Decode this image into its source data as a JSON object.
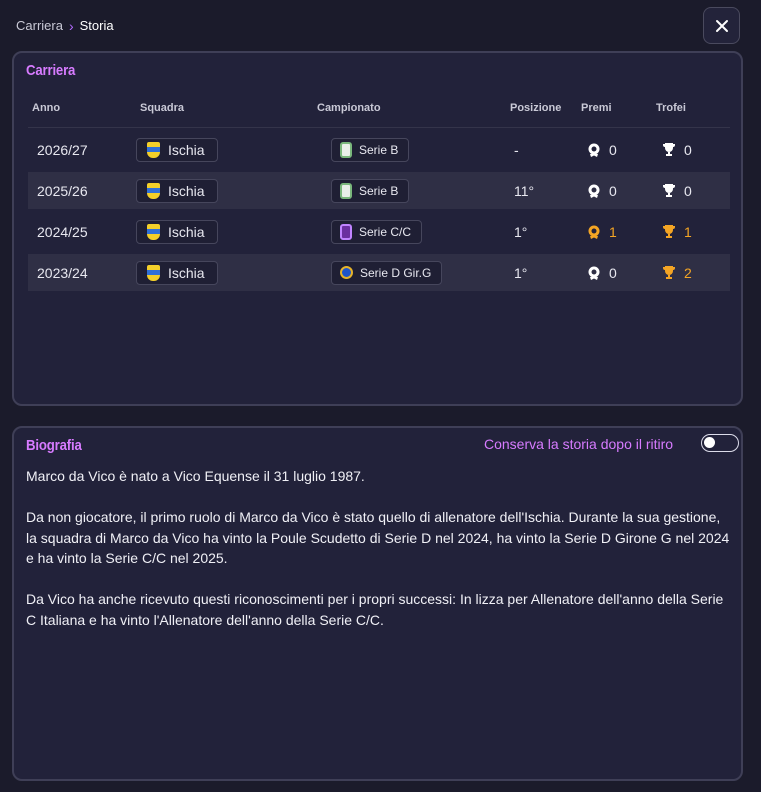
{
  "breadcrumb": {
    "parent": "Carriera",
    "current": "Storia"
  },
  "career": {
    "title": "Carriera",
    "columns": [
      "Anno",
      "Squadra",
      "Campionato",
      "Posizione",
      "Premi",
      "Trofei"
    ],
    "rows": [
      {
        "year": "2026/27",
        "team": "Ischia",
        "league": "Serie B",
        "league_icon": "serie-b-badge",
        "position": "-",
        "awards": "0",
        "trophies": "0",
        "awards_highlight": false,
        "trophies_highlight": false
      },
      {
        "year": "2025/26",
        "team": "Ischia",
        "league": "Serie B",
        "league_icon": "serie-b-badge",
        "position": "11°",
        "awards": "0",
        "trophies": "0",
        "awards_highlight": false,
        "trophies_highlight": false
      },
      {
        "year": "2024/25",
        "team": "Ischia",
        "league": "Serie C/C",
        "league_icon": "serie-c-badge",
        "position": "1°",
        "awards": "1",
        "trophies": "1",
        "awards_highlight": true,
        "trophies_highlight": true
      },
      {
        "year": "2023/24",
        "team": "Ischia",
        "league": "Serie D Gir.G",
        "league_icon": "serie-d-badge",
        "position": "1°",
        "awards": "0",
        "trophies": "2",
        "awards_highlight": false,
        "trophies_highlight": true
      }
    ]
  },
  "biography": {
    "title": "Biografia",
    "toggle_label": "Conserva la storia dopo il ritiro",
    "toggle_on": false,
    "paragraphs": [
      "Marco da Vico è nato a Vico Equense il 31 luglio 1987.",
      "Da non giocatore, il primo ruolo di Marco da Vico è stato quello di allenatore dell'Ischia. Durante la sua gestione, la squadra di Marco da Vico ha vinto la Poule Scudetto di Serie D nel 2024, ha vinto la Serie D Girone G nel 2024 e ha vinto la Serie C/C nel 2025.",
      "Da Vico ha anche ricevuto questi riconoscimenti per i propri successi: In lizza per Allenatore dell'anno della Serie C Italiana e ha vinto l'Allenatore dell'anno della Serie C/C."
    ]
  },
  "colors": {
    "accent": "#d77bff",
    "gold": "#f4a524",
    "background": "#1b1b2b",
    "panel": "#22223a"
  },
  "icons": {
    "close": "close-icon",
    "award": "award-medal-icon",
    "trophy": "trophy-icon",
    "chevron": "chevron-right-icon"
  }
}
